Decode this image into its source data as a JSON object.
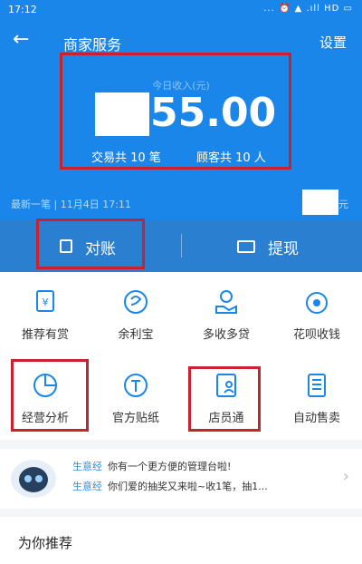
{
  "status_bar": {
    "time": "17:12",
    "right": "... ⏰ ▲ .ıll HD ▭"
  },
  "nav": {
    "back": "←",
    "title": "商家服务",
    "settings": "设置"
  },
  "income": {
    "label": "今日收入(元)",
    "amount": "55.00",
    "transactions": "交易共 10 笔",
    "customers": "顾客共 10 人"
  },
  "latest": {
    "text": "最新一笔 | 11月4日 17:11",
    "unit": "元"
  },
  "actions": {
    "reconcile": "对账",
    "withdraw": "提现"
  },
  "grid": [
    {
      "label": "推荐有赏",
      "icon": "reward-icon"
    },
    {
      "label": "余利宝",
      "icon": "yulibao-icon"
    },
    {
      "label": "多收多贷",
      "icon": "loan-icon"
    },
    {
      "label": "花呗收钱",
      "icon": "huabei-icon"
    },
    {
      "label": "经营分析",
      "icon": "pie-chart-icon"
    },
    {
      "label": "官方贴纸",
      "icon": "sticker-icon"
    },
    {
      "label": "店员通",
      "icon": "staff-icon"
    },
    {
      "label": "自动售卖",
      "icon": "vending-icon"
    }
  ],
  "news": {
    "tag": "生意经",
    "line1": "你有一个更方便的管理台啦!",
    "line2": "你们爱的抽奖又来啦~收1笔，抽1..."
  },
  "recommend": {
    "title": "为你推荐"
  },
  "colors": {
    "primary": "#1a86ea",
    "highlight": "#c8232c"
  }
}
